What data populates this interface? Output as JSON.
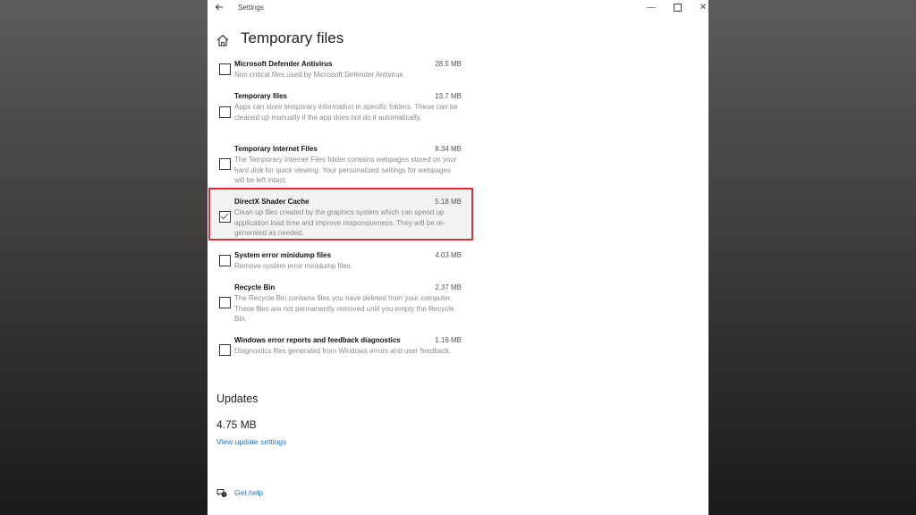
{
  "window": {
    "app_title": "Settings",
    "controls": {
      "minimize": "—",
      "close": "✕"
    }
  },
  "header": {
    "title": "Temporary files"
  },
  "items": [
    {
      "name": "Microsoft Defender Antivirus",
      "size": "28.5 MB",
      "description": "Non critical files used by Microsoft Defender Antivirus",
      "checked": false
    },
    {
      "name": "Temporary files",
      "size": "13.7 MB",
      "description": "Apps can store temporary information in specific folders. These can be cleaned up manually if the app does not do it automatically.",
      "checked": false
    },
    {
      "name": "Temporary Internet Files",
      "size": "8.34 MB",
      "description": "The Temporary Internet Files folder contains webpages stored on your hard disk for quick viewing. Your personalized settings for webpages will be left intact.",
      "checked": false
    },
    {
      "name": "DirectX Shader Cache",
      "size": "5.18 MB",
      "description": "Clean up files created by the graphics system which can speed up application load time and improve responsiveness. They will be re-generated as needed.",
      "checked": true,
      "highlighted": true
    },
    {
      "name": "System error minidump files",
      "size": "4.03 MB",
      "description": "Remove system error minidump files.",
      "checked": false
    },
    {
      "name": "Recycle Bin",
      "size": "2.37 MB",
      "description": "The Recycle Bin contains files you have deleted from your computer. These files are not permanently removed until you empty the Recycle Bin.",
      "checked": false
    },
    {
      "name": "Windows error reports and feedback diagnostics",
      "size": "1.16 MB",
      "description": "Diagnostics files generated from Windows errors and user feedback.",
      "checked": false
    }
  ],
  "updates": {
    "heading": "Updates",
    "size": "4.75 MB",
    "link": "View update settings"
  },
  "help": {
    "label": "Get help"
  },
  "colors": {
    "highlight_border": "#d6323a",
    "link": "#1b72c4"
  }
}
